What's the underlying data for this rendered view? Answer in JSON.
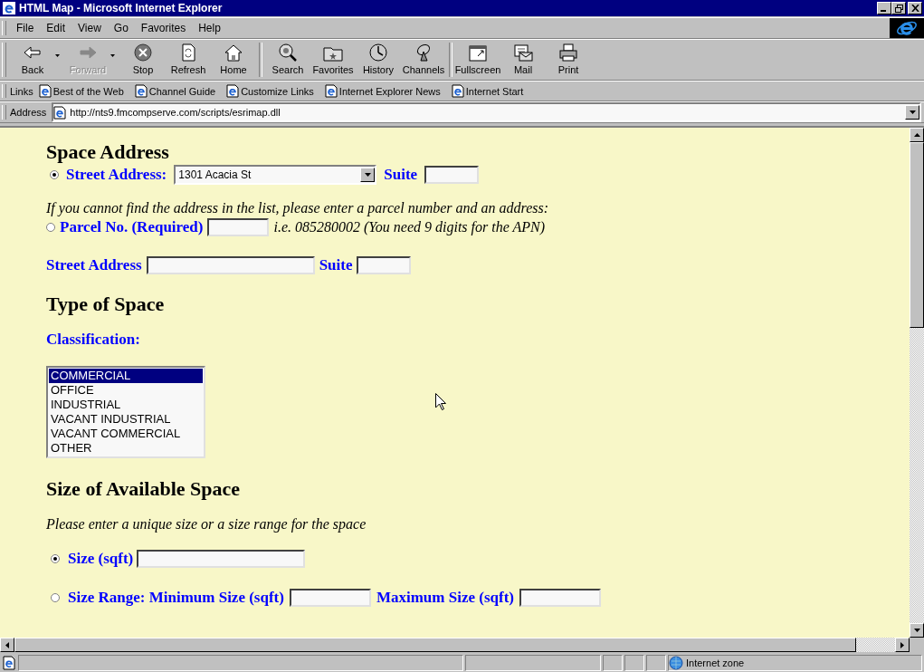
{
  "window": {
    "title": "HTML Map - Microsoft Internet Explorer"
  },
  "menu": [
    "File",
    "Edit",
    "View",
    "Go",
    "Favorites",
    "Help"
  ],
  "toolbar": [
    [
      {
        "label": "Back",
        "disabled": false,
        "dropdown": true
      },
      {
        "label": "Forward",
        "disabled": true,
        "dropdown": true
      },
      {
        "label": "Stop",
        "disabled": false,
        "dropdown": false
      },
      {
        "label": "Refresh",
        "disabled": false,
        "dropdown": false
      },
      {
        "label": "Home",
        "disabled": false,
        "dropdown": false
      }
    ],
    [
      {
        "label": "Search",
        "disabled": false,
        "dropdown": false
      },
      {
        "label": "Favorites",
        "disabled": false,
        "dropdown": false
      },
      {
        "label": "History",
        "disabled": false,
        "dropdown": false
      },
      {
        "label": "Channels",
        "disabled": false,
        "dropdown": false
      }
    ],
    [
      {
        "label": "Fullscreen",
        "disabled": false,
        "dropdown": false
      },
      {
        "label": "Mail",
        "disabled": false,
        "dropdown": false
      },
      {
        "label": "Print",
        "disabled": false,
        "dropdown": false
      }
    ]
  ],
  "links": {
    "label": "Links",
    "items": [
      "Best of the Web",
      "Channel Guide",
      "Customize Links",
      "Internet Explorer News",
      "Internet Start"
    ]
  },
  "address": {
    "label": "Address",
    "value": "http://nts9.fmcompserve.com/scripts/esrimap.dll"
  },
  "space_address": {
    "heading": "Space Address",
    "street_option": {
      "label": "Street Address:",
      "selected": true,
      "value": "1301 Acacia St"
    },
    "suite_label": "Suite",
    "hint": "If you cannot find the address in the list, please enter a parcel number and an address:",
    "parcel_option": {
      "label": "Parcel No. (Required)",
      "selected": false
    },
    "parcel_example": "i.e. 085280002 (You need 9 digits for the APN)",
    "street_label": "Street Address",
    "suite_label_2": "Suite"
  },
  "type_of_space": {
    "heading": "Type of Space",
    "classification_label": "Classification:",
    "options": [
      {
        "label": "COMMERCIAL",
        "selected": true
      },
      {
        "label": "OFFICE",
        "selected": false
      },
      {
        "label": "INDUSTRIAL",
        "selected": false
      },
      {
        "label": "VACANT INDUSTRIAL",
        "selected": false
      },
      {
        "label": "VACANT COMMERCIAL",
        "selected": false
      },
      {
        "label": "OTHER",
        "selected": false
      }
    ]
  },
  "size": {
    "heading": "Size of Available Space",
    "hint": "Please enter a unique size or a size range for the space",
    "size_option": {
      "label": "Size (sqft)",
      "selected": true
    },
    "range_option": {
      "label": "Size Range: Minimum Size (sqft)",
      "selected": false
    },
    "max_label": "Maximum Size (sqft)"
  },
  "status_bar": {
    "zone": "Internet zone"
  }
}
